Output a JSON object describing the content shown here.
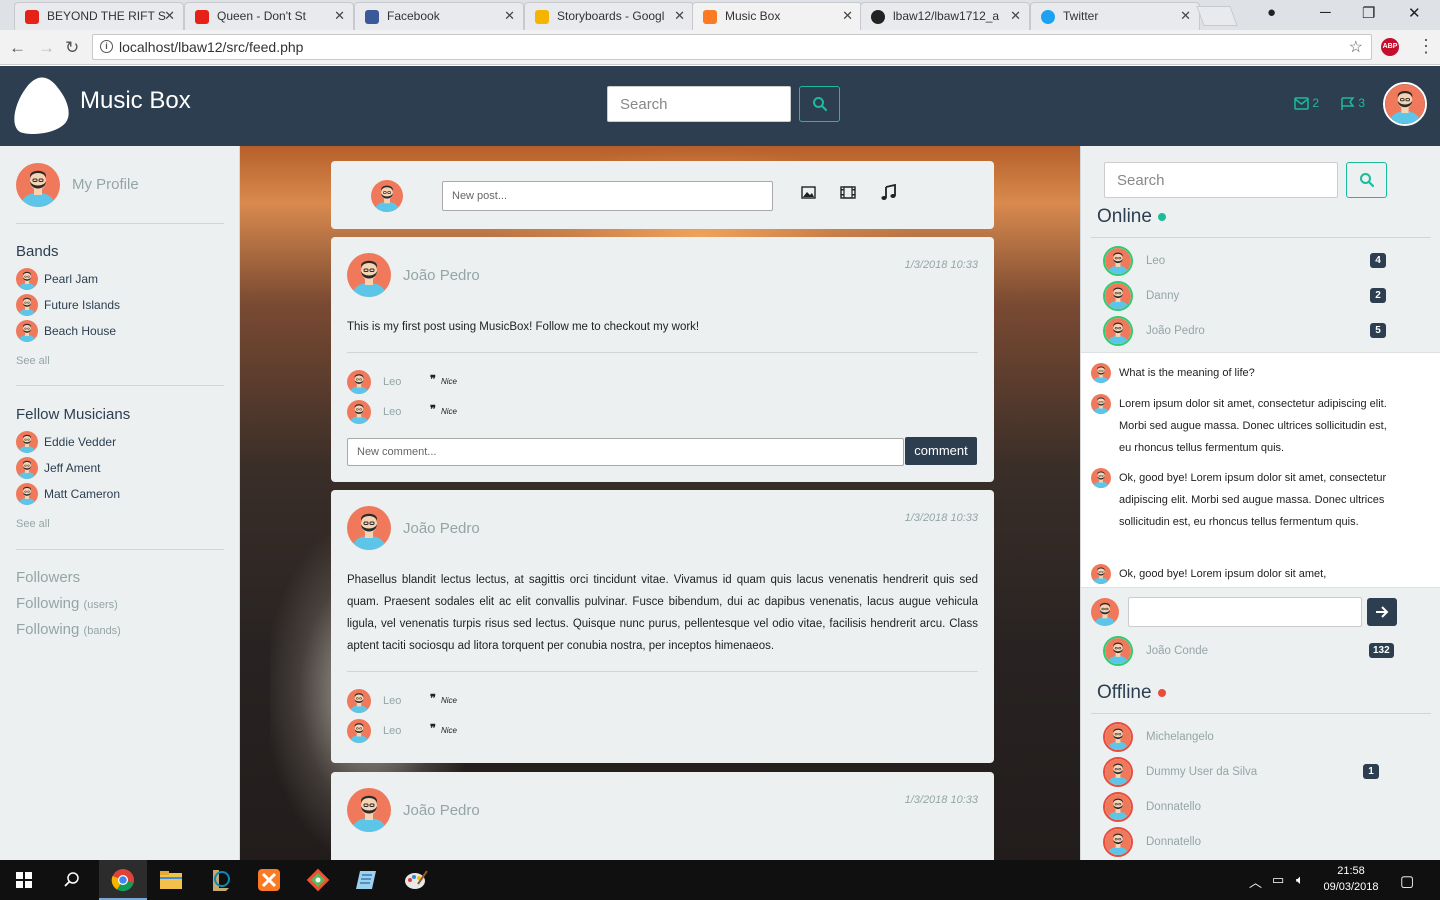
{
  "browser": {
    "tabs": [
      {
        "label": "BEYOND THE RIFT S",
        "icon": "youtube-icon",
        "color": "#e62117"
      },
      {
        "label": "Queen - Don't St",
        "icon": "youtube-icon",
        "color": "#e62117"
      },
      {
        "label": "Facebook",
        "icon": "facebook-icon",
        "color": "#3b5998"
      },
      {
        "label": "Storyboards - Googl",
        "icon": "drive-icon",
        "color": "#f4b400"
      },
      {
        "label": "Music Box",
        "icon": "xampp-icon",
        "color": "#fb7a24"
      },
      {
        "label": "lbaw12/lbaw1712_a",
        "icon": "github-icon",
        "color": "#222222"
      },
      {
        "label": "Twitter",
        "icon": "twitter-icon",
        "color": "#1da1f2"
      }
    ],
    "url": "localhost/lbaw12/src/feed.php",
    "abp_label": "ABP"
  },
  "header": {
    "brand": "Music Box",
    "search_placeholder": "Search",
    "messages_count": "2",
    "notifications_count": "3"
  },
  "left": {
    "profile_label": "My Profile",
    "bands_title": "Bands",
    "bands": [
      "Pearl Jam",
      "Future Islands",
      "Beach House"
    ],
    "bands_see_all": "See all",
    "musicians_title": "Fellow Musicians",
    "musicians": [
      "Eddie Vedder",
      "Jeff Ament",
      "Matt Cameron"
    ],
    "musicians_see_all": "See all",
    "followers": "Followers",
    "following": "Following",
    "following_users": "(users)",
    "following_bands": "(bands)"
  },
  "composer": {
    "placeholder": "New post..."
  },
  "posts": [
    {
      "author": "João Pedro",
      "date": "1/3/2018 10:33",
      "text": "This is my first post using MusicBox! Follow me to checkout my work!",
      "comments": [
        {
          "name": "Leo",
          "text": "Nice"
        },
        {
          "name": "Leo",
          "text": "Nice"
        }
      ],
      "comment_placeholder": "New comment...",
      "comment_button": "comment"
    },
    {
      "author": "João Pedro",
      "date": "1/3/2018 10:33",
      "text": "Phasellus blandit lectus lectus, at sagittis orci tincidunt vitae. Vivamus id quam quis lacus venenatis hendrerit quis sed quam. Praesent sodales elit ac elit convallis pulvinar. Fusce bibendum, dui ac dapibus venenatis, lacus augue vehicula ligula, vel venenatis turpis risus sed lectus. Quisque nunc purus, pellentesque vel odio vitae, facilisis hendrerit arcu. Class aptent taciti sociosqu ad litora torquent per conubia nostra, per inceptos himenaeos.",
      "comments": [
        {
          "name": "Leo",
          "text": "Nice"
        },
        {
          "name": "Leo",
          "text": "Nice"
        }
      ]
    },
    {
      "author": "João Pedro",
      "date": "1/3/2018 10:33"
    }
  ],
  "right": {
    "search_placeholder": "Search",
    "online_title": "Online",
    "online": [
      {
        "name": "Leo",
        "badge": "4"
      },
      {
        "name": "Danny",
        "badge": "2"
      },
      {
        "name": "João Pedro",
        "badge": "5"
      }
    ],
    "chat_messages": [
      "What is the meaning of life?",
      "Lorem ipsum dolor sit amet, consectetur adipiscing elit. Morbi sed augue massa. Donec ultrices sollicitudin est, eu rhoncus tellus fermentum quis.",
      "Ok, good bye! Lorem ipsum dolor sit amet, consectetur adipiscing elit. Morbi sed augue massa. Donec ultrices sollicitudin est, eu rhoncus tellus fermentum quis.",
      "Ok, good bye! Lorem ipsum dolor sit amet,"
    ],
    "chat_user": {
      "name": "João Conde",
      "badge": "132"
    },
    "offline_title": "Offline",
    "offline": [
      {
        "name": "Michelangelo",
        "badge": ""
      },
      {
        "name": "Dummy User da Silva",
        "badge": "1"
      },
      {
        "name": "Donnatello",
        "badge": ""
      },
      {
        "name": "Donnatello",
        "badge": ""
      }
    ]
  },
  "taskbar": {
    "time": "21:58",
    "date": "09/03/2018"
  },
  "colors": {
    "primary": "#2c3e50",
    "accent": "#1abc9c",
    "online": "#2ecc71",
    "offline": "#e74c3c",
    "avatar": "#f0795b"
  }
}
